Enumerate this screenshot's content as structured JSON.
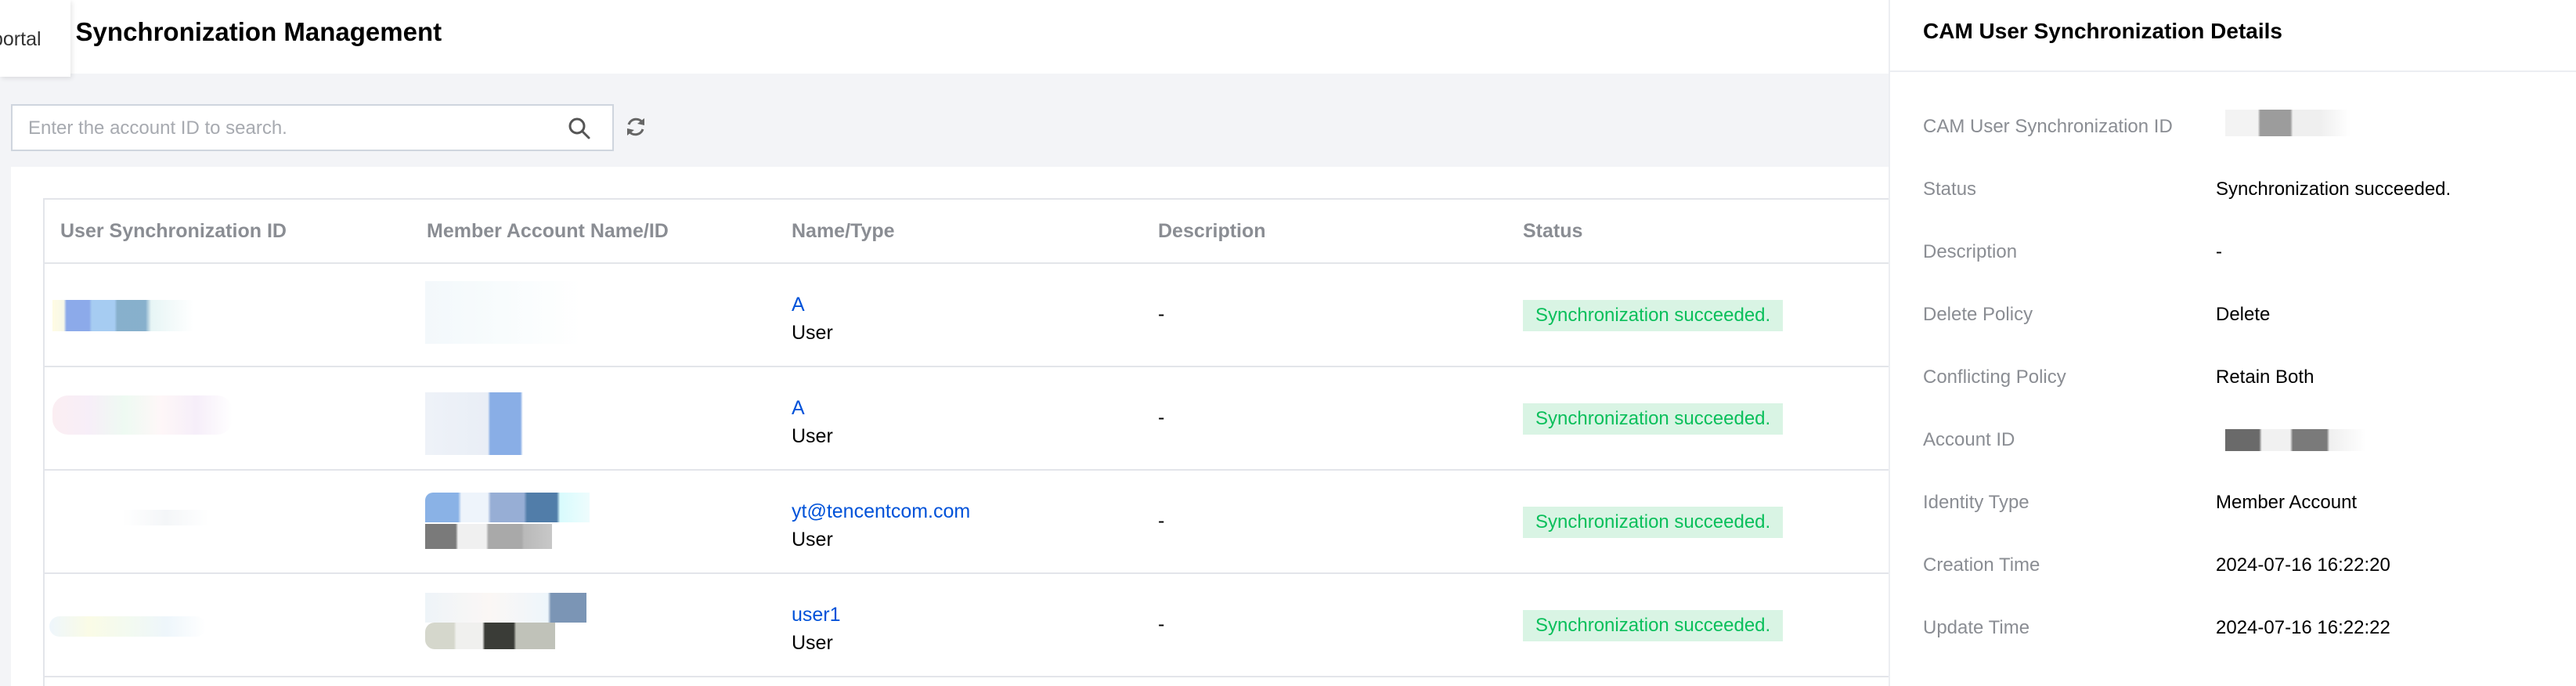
{
  "header": {
    "portal_label": "portal",
    "page_title": "User Synchronization Management"
  },
  "search": {
    "placeholder": "Enter the account ID to search."
  },
  "table": {
    "columns": [
      "User Synchronization ID",
      "Member Account Name/ID",
      "Name/Type",
      "Description",
      "Status"
    ],
    "rows": [
      {
        "name": "A",
        "type": "User",
        "description": "-",
        "status": "Synchronization succeeded."
      },
      {
        "name": "A",
        "type": "User",
        "description": "-",
        "status": "Synchronization succeeded."
      },
      {
        "name": "yt@tencentcom.com",
        "type": "User",
        "description": "-",
        "status": "Synchronization succeeded."
      },
      {
        "name": "user1",
        "type": "User",
        "description": "-",
        "status": "Synchronization succeeded."
      }
    ]
  },
  "details_panel": {
    "title": "CAM User Synchronization Details",
    "fields": [
      {
        "label": "CAM User Synchronization ID",
        "value": ""
      },
      {
        "label": "Status",
        "value": "Synchronization succeeded."
      },
      {
        "label": "Description",
        "value": "-"
      },
      {
        "label": "Delete Policy",
        "value": "Delete"
      },
      {
        "label": "Conflicting Policy",
        "value": "Retain Both"
      },
      {
        "label": "Account ID",
        "value": ""
      },
      {
        "label": "Identity Type",
        "value": "Member Account"
      },
      {
        "label": "Creation Time",
        "value": "2024-07-16 16:22:20"
      },
      {
        "label": "Update Time",
        "value": "2024-07-16 16:22:22"
      }
    ]
  },
  "colors": {
    "link": "#0052d9",
    "success_text": "#0abf5b",
    "success_bg": "#d9f4e4",
    "page_bg": "#f3f4f7"
  },
  "icons": [
    "search-icon",
    "refresh-icon"
  ]
}
